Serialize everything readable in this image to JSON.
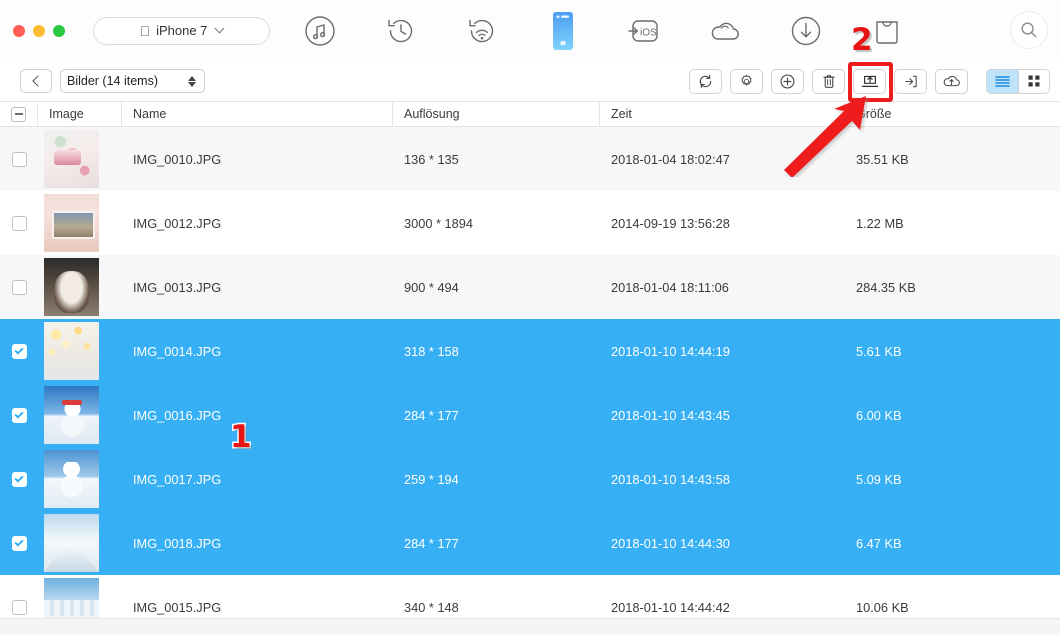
{
  "window": {
    "traffic_lights": [
      "close",
      "minimize",
      "maximize"
    ],
    "device_label": "iPhone 7",
    "apple_glyph": ""
  },
  "nav": {
    "items": [
      {
        "name": "media-icon",
        "label": "Media"
      },
      {
        "name": "history-icon",
        "label": "Backup History"
      },
      {
        "name": "wifi-icon",
        "label": "Wireless Transfer"
      },
      {
        "name": "device-icon",
        "label": "Device",
        "active": true
      },
      {
        "name": "to-ios-icon",
        "label": "To iOS"
      },
      {
        "name": "cloud-icon",
        "label": "iCloud"
      },
      {
        "name": "download-icon",
        "label": "Download"
      },
      {
        "name": "toolkit-icon",
        "label": "Toolkit"
      }
    ],
    "search_label": "Search"
  },
  "actionbar": {
    "back_label": "Back",
    "path_label": "Bilder (14 items)",
    "tools": [
      {
        "name": "refresh-button",
        "label": "Refresh"
      },
      {
        "name": "settings-button",
        "label": "Settings"
      },
      {
        "name": "add-button",
        "label": "Add"
      },
      {
        "name": "delete-button",
        "label": "Delete"
      },
      {
        "name": "export-to-pc-button",
        "label": "Export to Computer",
        "highlighted": true
      },
      {
        "name": "import-button",
        "label": "Import"
      },
      {
        "name": "upload-cloud-button",
        "label": "Upload to Cloud"
      }
    ],
    "view_modes": [
      {
        "name": "list-view-button",
        "label": "List view",
        "active": true
      },
      {
        "name": "grid-view-button",
        "label": "Grid view",
        "active": false
      }
    ]
  },
  "table": {
    "select_all_state": "indeterminate",
    "columns": [
      "Image",
      "Name",
      "Auflösung",
      "Zeit",
      "Größe"
    ],
    "rows": [
      {
        "selected": false,
        "thumb": "t-cake",
        "name": "IMG_0010.JPG",
        "resolution": "136 * 135",
        "time": "2018-01-04 18:02:47",
        "size": "35.51 KB"
      },
      {
        "selected": false,
        "thumb": "t-phone",
        "name": "IMG_0012.JPG",
        "resolution": "3000 * 1894",
        "time": "2014-09-19 13:56:28",
        "size": "1.22 MB"
      },
      {
        "selected": false,
        "thumb": "t-cat",
        "name": "IMG_0013.JPG",
        "resolution": "900 * 494",
        "time": "2018-01-04 18:11:06",
        "size": "284.35 KB"
      },
      {
        "selected": true,
        "thumb": "t-bokeh",
        "name": "IMG_0014.JPG",
        "resolution": "318 * 158",
        "time": "2018-01-10 14:44:19",
        "size": "5.61 KB"
      },
      {
        "selected": true,
        "thumb": "t-snowman1",
        "name": "IMG_0016.JPG",
        "resolution": "284 * 177",
        "time": "2018-01-10 14:43:45",
        "size": "6.00 KB"
      },
      {
        "selected": true,
        "thumb": "t-snowman2",
        "name": "IMG_0017.JPG",
        "resolution": "259 * 194",
        "time": "2018-01-10 14:43:58",
        "size": "5.09 KB"
      },
      {
        "selected": true,
        "thumb": "t-road",
        "name": "IMG_0018.JPG",
        "resolution": "284 * 177",
        "time": "2018-01-10 14:44:30",
        "size": "6.47 KB"
      },
      {
        "selected": false,
        "thumb": "t-trees",
        "name": "IMG_0015.JPG",
        "resolution": "340 * 148",
        "time": "2018-01-10 14:44:42",
        "size": "10.06 KB"
      }
    ]
  },
  "annotations": {
    "step_one": "1",
    "step_two": "2"
  },
  "colors": {
    "selection_blue": "#37aff4",
    "annotation_red": "#e81414",
    "active_tab_blue": "#4aa8f5"
  }
}
